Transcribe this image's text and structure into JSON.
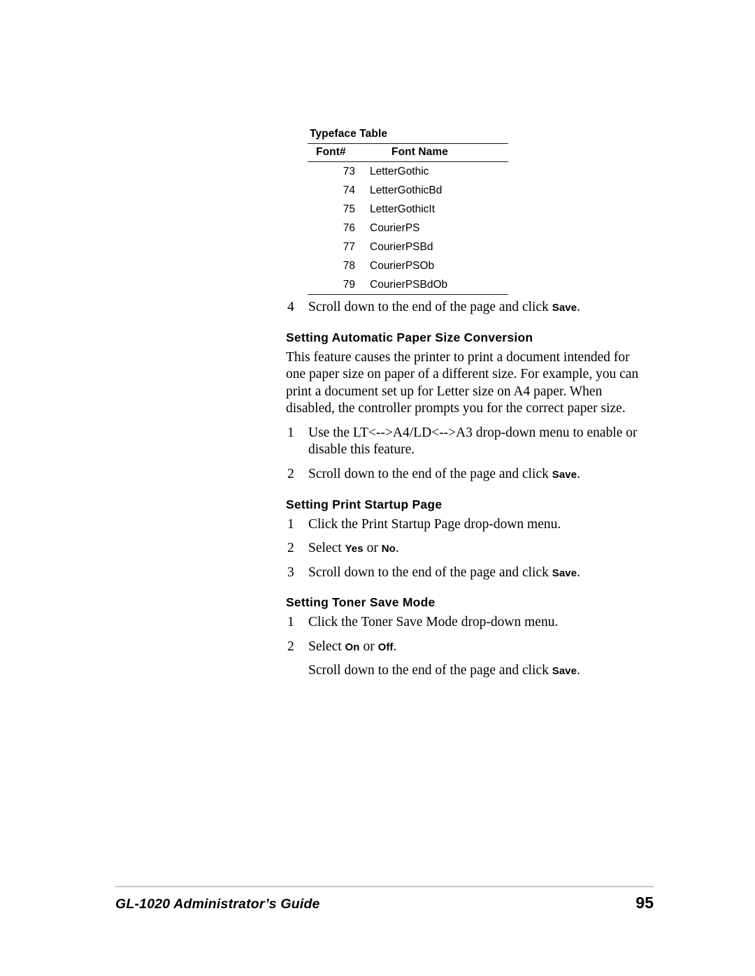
{
  "table": {
    "caption": "Typeface Table",
    "columns": [
      "Font#",
      "Font Name"
    ],
    "rows": [
      {
        "num": "73",
        "name": "LetterGothic"
      },
      {
        "num": "74",
        "name": "LetterGothicBd"
      },
      {
        "num": "75",
        "name": "LetterGothicIt"
      },
      {
        "num": "76",
        "name": "CourierPS"
      },
      {
        "num": "77",
        "name": "CourierPSBd"
      },
      {
        "num": "78",
        "name": "CourierPSOb"
      },
      {
        "num": "79",
        "name": "CourierPSBdOb"
      }
    ]
  },
  "content": {
    "step4": {
      "num": "4",
      "text_before": "Scroll down to the end of the page and click ",
      "ui": "Save",
      "text_after": "."
    },
    "section1": {
      "heading": "Setting Automatic Paper Size Conversion",
      "paragraph": "This feature causes the printer to print a document intended for one paper size on paper of a different size. For example, you can print a document set up for Letter size on A4 paper. When disabled, the controller prompts you for the correct paper size.",
      "steps": [
        {
          "num": "1",
          "text_before": "Use the LT<-->A4/LD<-->A3 drop-down menu to enable or disable this feature.",
          "ui": "",
          "text_after": ""
        },
        {
          "num": "2",
          "text_before": "Scroll down to the end of the page and click ",
          "ui": "Save",
          "text_after": "."
        }
      ]
    },
    "section2": {
      "heading": "Setting Print Startup Page",
      "steps": [
        {
          "num": "1",
          "text_before": "Click the Print Startup Page drop-down menu.",
          "ui": "",
          "text_after": ""
        },
        {
          "num": "2",
          "text_before": "Select ",
          "ui": "Yes",
          "mid": " or ",
          "ui2": "No",
          "text_after": "."
        },
        {
          "num": "3",
          "text_before": "Scroll down to the end of the page and click ",
          "ui": "Save",
          "text_after": "."
        }
      ]
    },
    "section3": {
      "heading": "Setting Toner Save Mode",
      "steps": [
        {
          "num": "1",
          "text_before": "Click the Toner Save Mode drop-down menu.",
          "ui": "",
          "text_after": ""
        },
        {
          "num": "2",
          "text_before": "Select ",
          "ui": "On",
          "mid": " or ",
          "ui2": "Off",
          "text_after": "."
        },
        {
          "num": "",
          "text_before": "Scroll down to the end of the page and click ",
          "ui": "Save",
          "text_after": "."
        }
      ]
    }
  },
  "footer": {
    "title": "GL-1020 Administrator’s Guide",
    "page": "95"
  }
}
